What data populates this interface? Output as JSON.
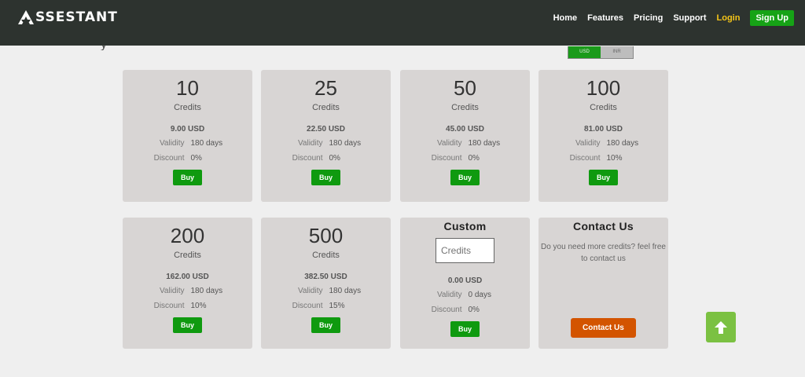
{
  "brand": {
    "name": "SSESTANT"
  },
  "nav": {
    "home": "Home",
    "features": "Features",
    "pricing": "Pricing",
    "support": "Support",
    "login": "Login",
    "signup": "Sign Up"
  },
  "currency": {
    "options": [
      "USD",
      "INR"
    ],
    "selected": "USD"
  },
  "labels": {
    "credits": "Credits",
    "validity": "Validity",
    "discount": "Discount",
    "buy": "Buy"
  },
  "plans": [
    {
      "credits": "10",
      "price": "9.00 USD",
      "validity": "180 days",
      "discount": "0%"
    },
    {
      "credits": "25",
      "price": "22.50 USD",
      "validity": "180 days",
      "discount": "0%"
    },
    {
      "credits": "50",
      "price": "45.00 USD",
      "validity": "180 days",
      "discount": "0%"
    },
    {
      "credits": "100",
      "price": "81.00 USD",
      "validity": "180 days",
      "discount": "10%"
    },
    {
      "credits": "200",
      "price": "162.00 USD",
      "validity": "180 days",
      "discount": "10%"
    },
    {
      "credits": "500",
      "price": "382.50 USD",
      "validity": "180 days",
      "discount": "15%"
    }
  ],
  "custom": {
    "title": "Custom",
    "placeholder": "Credits",
    "price": "0.00 USD",
    "validity": "0 days",
    "discount": "0%"
  },
  "contact": {
    "title": "Contact Us",
    "text": "Do you need more credits? feel free to contact us",
    "button": "Contact Us"
  },
  "colors": {
    "navbar": "#2d332f",
    "buy_green": "#0f9a0f",
    "login_yellow": "#f5c518",
    "contact_orange": "#d35400",
    "scroll_top_green": "#7bc142",
    "card_bg": "#d8d5d4"
  },
  "icons": {
    "scroll_top": "arrow-up-icon",
    "logo": "logo-a-icon"
  }
}
